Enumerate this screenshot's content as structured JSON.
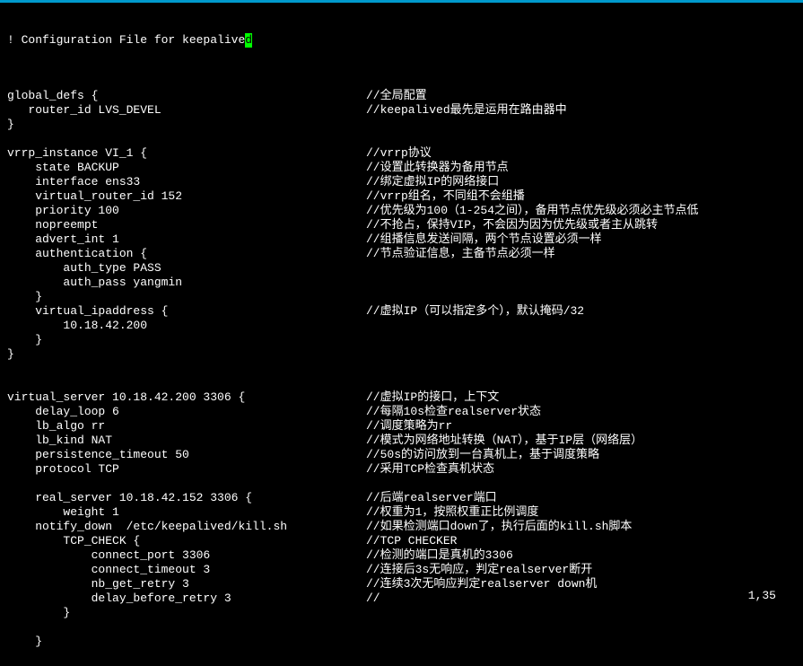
{
  "title_prefix": "! Configuration File for keepalive",
  "title_cursor": "d",
  "lines": [
    {
      "code": "",
      "comment": ""
    },
    {
      "code": "global_defs {",
      "comment": "//全局配置"
    },
    {
      "code": "   router_id LVS_DEVEL",
      "comment": "//keepalived最先是运用在路由器中"
    },
    {
      "code": "}",
      "comment": ""
    },
    {
      "code": "",
      "comment": ""
    },
    {
      "code": "vrrp_instance VI_1 {",
      "comment": "//vrrp协议"
    },
    {
      "code": "    state BACKUP",
      "comment": "//设置此转换器为备用节点"
    },
    {
      "code": "    interface ens33",
      "comment": "//绑定虚拟IP的网络接口"
    },
    {
      "code": "    virtual_router_id 152",
      "comment": "//vrrp组名，不同组不会组播"
    },
    {
      "code": "    priority 100",
      "comment": "//优先级为100（1-254之间），备用节点优先级必须必主节点低"
    },
    {
      "code": "    nopreempt",
      "comment": "//不抢占，保持VIP，不会因为因为优先级或者主从跳转"
    },
    {
      "code": "    advert_int 1",
      "comment": "//组播信息发送间隔，两个节点设置必须一样"
    },
    {
      "code": "    authentication {",
      "comment": "//节点验证信息，主备节点必须一样"
    },
    {
      "code": "        auth_type PASS",
      "comment": ""
    },
    {
      "code": "        auth_pass yangmin",
      "comment": ""
    },
    {
      "code": "    }",
      "comment": ""
    },
    {
      "code": "    virtual_ipaddress {",
      "comment": "//虚拟IP（可以指定多个），默认掩码/32"
    },
    {
      "code": "        10.18.42.200",
      "comment": ""
    },
    {
      "code": "    }",
      "comment": ""
    },
    {
      "code": "}",
      "comment": ""
    },
    {
      "code": "",
      "comment": ""
    },
    {
      "code": "",
      "comment": ""
    },
    {
      "code": "virtual_server 10.18.42.200 3306 {",
      "comment": "//虚拟IP的接口，上下文"
    },
    {
      "code": "    delay_loop 6",
      "comment": "//每隔10s检查realserver状态"
    },
    {
      "code": "    lb_algo rr",
      "comment": "//调度策略为rr"
    },
    {
      "code": "    lb_kind NAT",
      "comment": "//模式为网络地址转换（NAT），基于IP层（网络层）"
    },
    {
      "code": "    persistence_timeout 50",
      "comment": "//50s的访问放到一台真机上，基于调度策略"
    },
    {
      "code": "    protocol TCP",
      "comment": "//采用TCP检查真机状态"
    },
    {
      "code": "",
      "comment": ""
    },
    {
      "code": "    real_server 10.18.42.152 3306 {",
      "comment": "//后端realserver端口"
    },
    {
      "code": "        weight 1",
      "comment": "//权重为1，按照权重正比例调度"
    },
    {
      "code": "    notify_down  /etc/keepalived/kill.sh",
      "comment": "//如果检测端口down了，执行后面的kill.sh脚本"
    },
    {
      "code": "        TCP_CHECK {",
      "comment": "//TCP CHECKER"
    },
    {
      "code": "            connect_port 3306",
      "comment": "//检测的端口是真机的3306"
    },
    {
      "code": "            connect_timeout 3",
      "comment": "//连接后3s无响应，判定realserver断开"
    },
    {
      "code": "            nb_get_retry 3",
      "comment": "//连续3次无响应判定realserver down机"
    },
    {
      "code": "            delay_before_retry 3",
      "comment": "//"
    },
    {
      "code": "        }",
      "comment": ""
    },
    {
      "code": "",
      "comment": ""
    },
    {
      "code": "    }",
      "comment": ""
    }
  ],
  "status": "1,35"
}
